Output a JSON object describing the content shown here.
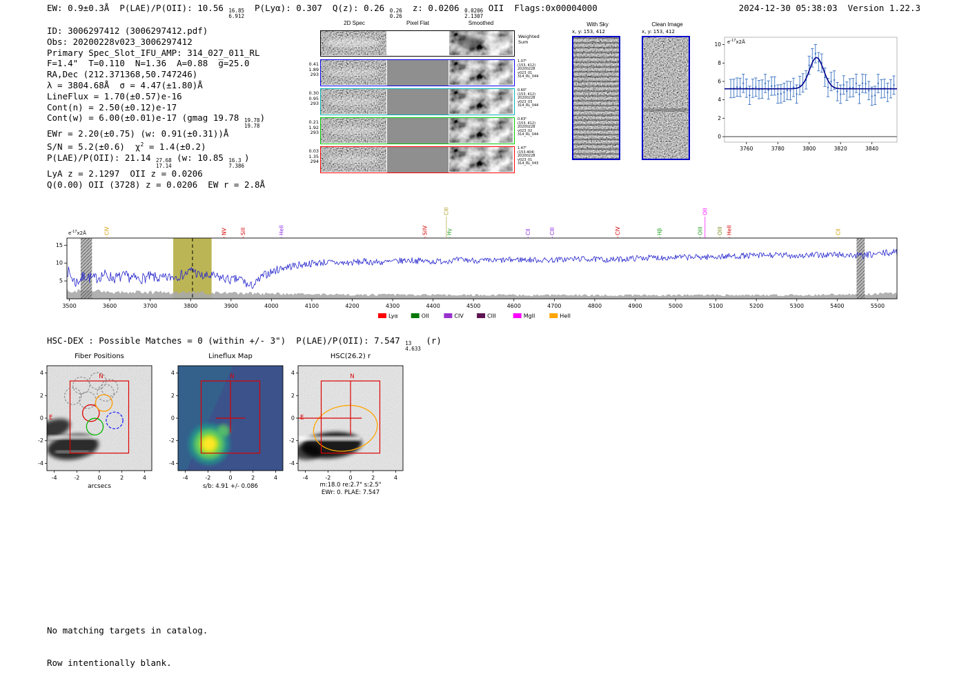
{
  "header": {
    "segments": [
      {
        "t": "EW: 0.9±0.3Å  P(LAE)/P(OII): 10.56 "
      },
      {
        "frac": [
          "16.85",
          "6.912"
        ]
      },
      {
        "t": "  P(Lyα): 0.307  Q(z): 0.26 "
      },
      {
        "frac": [
          "0.26",
          "0.26"
        ]
      },
      {
        "t": "  z: 0.0206 "
      },
      {
        "frac": [
          "0.0206",
          "2.1307"
        ]
      },
      {
        "t": " OII  Flags:0x00004000"
      }
    ],
    "timestamp": "2024-12-30 05:38:03  Version 1.22.3"
  },
  "info_lines": [
    [
      {
        "t": "ID: 3006297412 (3006297412.pdf)"
      }
    ],
    [
      {
        "t": "Obs: 20200228v023_3006297412"
      }
    ],
    [
      {
        "t": "Primary Spec_Slot_IFU_AMP: 314_027_011_RL"
      }
    ],
    [
      {
        "t": "F=1.4\"  T=0.110  N=1.36  A=0.88  g̅=25.0"
      }
    ],
    [
      {
        "t": "RA,Dec (212.371368,50.747246)"
      }
    ],
    [
      {
        "t": "λ = 3804.68Å  σ = 4.47(±1.80)Å"
      }
    ],
    [
      {
        "t": "LineFlux = 1.70(±0.57)e-16"
      }
    ],
    [
      {
        "t": "Cont(n) = 2.50(±0.12)e-17"
      }
    ],
    [
      {
        "t": "Cont(w) = 6.00(±0.01)e-17 (gmag 19.78 "
      },
      {
        "frac": [
          "19.78",
          "19.78"
        ]
      },
      {
        "t": ")"
      }
    ],
    [
      {
        "t": "EWr = 2.20(±0.75) (w: 0.91(±0.31))Å"
      }
    ],
    [
      {
        "t": "S/N = 5.2(±0.6)  χ"
      },
      {
        "sup": "2"
      },
      {
        "t": " = 1.4(±0.2)"
      }
    ],
    [
      {
        "t": "P(LAE)/P(OII): 21.14 "
      },
      {
        "frac": [
          "27.68",
          "17.14"
        ]
      },
      {
        "t": " (w: 10.85 "
      },
      {
        "frac": [
          "16.3",
          "7.386"
        ]
      },
      {
        "t": ")"
      }
    ],
    [
      {
        "t": "LyA z = 2.1297  OII z = 0.0206"
      }
    ],
    [
      {
        "t": "Q(0.00) OII (3728) z = 0.0206  EW r = 2.8Å"
      }
    ]
  ],
  "cutouts": {
    "col_titles": [
      "2D Spec",
      "Pixel Flat",
      "Smoothed"
    ],
    "weighted_label_1": "Weighted",
    "weighted_label_2": "Sum",
    "rows": [
      {
        "left": [
          "0.41",
          "1.89",
          "293"
        ],
        "right": [
          "1.07\"",
          "(153, 412)",
          "20200228",
          "v023_01",
          "314_RL_044"
        ],
        "border": "#0000ee"
      },
      {
        "left": [
          "0.30",
          "0.95",
          "293"
        ],
        "right": [
          "0.60\"",
          "(153, 412)",
          "20200228",
          "v023_03",
          "314_RL_044"
        ],
        "border": "#00b2b2"
      },
      {
        "left": [
          "0.21",
          "1.92",
          "293"
        ],
        "right": [
          "0.83\"",
          "(153, 412)",
          "20200228",
          "v023_02",
          "314_RL_044"
        ],
        "border": "#00cc00"
      },
      {
        "left": [
          "0.03",
          "1.35",
          "294"
        ],
        "right": [
          "1.47\"",
          "(153.404)",
          "20200228",
          "v023_01",
          "314_RL_043"
        ],
        "border": "#ff0000"
      }
    ]
  },
  "sky_panels": [
    {
      "title": "With Sky",
      "coords": "x, y: 153, 412"
    },
    {
      "title": "Clean Image",
      "coords": "x, y: 153, 412"
    }
  ],
  "chart_data": [
    {
      "id": "line-fit-zoom",
      "type": "scatter",
      "title": "",
      "unit_label": {
        "base": "e",
        "exp": "-17",
        "rest": "x2Å"
      },
      "xlim": [
        3746,
        3856
      ],
      "ylim": [
        -0.6,
        10.8
      ],
      "xticks": [
        3760,
        3780,
        3800,
        3820,
        3840
      ],
      "yticks": [
        0,
        2,
        4,
        6,
        8,
        10
      ],
      "model": {
        "baseline": 5.2,
        "mu": 3804.68,
        "sigma": 4.47,
        "amplitude": 3.4
      },
      "points": {
        "x_start": 3750,
        "x_step": 2,
        "n": 53,
        "noise_amp": 0.85,
        "error_bar": 1.0,
        "seed": 11
      },
      "colors": {
        "marker": "#3a72c0",
        "fit": "#00008b",
        "zero_line": "#8f8f8f"
      }
    },
    {
      "id": "full-spectrum",
      "type": "line",
      "title": "",
      "unit_label": {
        "base": "e",
        "exp": "-17",
        "rest": "x2Å"
      },
      "xlim": [
        3494,
        5548
      ],
      "ylim": [
        0,
        17
      ],
      "xticks": [
        3500,
        3600,
        3700,
        3800,
        3900,
        4000,
        4100,
        4200,
        4300,
        4400,
        4500,
        4600,
        4700,
        4800,
        4900,
        5000,
        5100,
        5200,
        5300,
        5400,
        5500
      ],
      "yticks": [
        5,
        10,
        15
      ],
      "step": 2,
      "seed": 4,
      "detect_wavelength": 3804.68,
      "highlight_band": [
        3757,
        3852
      ],
      "hatch_bands": [
        [
          3528,
          3556
        ],
        [
          5448,
          5468
        ]
      ],
      "colors": {
        "line": "#2222cc",
        "error_band": "#a8a8a8",
        "highlight": "#b5ad42"
      },
      "continuum": [
        [
          3494,
          8.0
        ],
        [
          3515,
          4.5
        ],
        [
          3540,
          6.5
        ],
        [
          3560,
          5.5
        ],
        [
          3585,
          6.8
        ],
        [
          3610,
          5.8
        ],
        [
          3640,
          6.3
        ],
        [
          3670,
          5.5
        ],
        [
          3700,
          6.2
        ],
        [
          3730,
          5.6
        ],
        [
          3760,
          6.3
        ],
        [
          3785,
          6.8
        ],
        [
          3800,
          7.8
        ],
        [
          3806,
          8.3
        ],
        [
          3815,
          7.0
        ],
        [
          3830,
          6.2
        ],
        [
          3850,
          6.4
        ],
        [
          3880,
          5.8
        ],
        [
          3900,
          5.2
        ],
        [
          3925,
          5.6
        ],
        [
          3945,
          3.4
        ],
        [
          3960,
          4.2
        ],
        [
          3980,
          6.5
        ],
        [
          4000,
          7.5
        ],
        [
          4030,
          8.8
        ],
        [
          4060,
          9.3
        ],
        [
          4090,
          9.8
        ],
        [
          4130,
          10.2
        ],
        [
          4180,
          10.0
        ],
        [
          4230,
          10.4
        ],
        [
          4280,
          10.2
        ],
        [
          4340,
          10.8
        ],
        [
          4400,
          10.4
        ],
        [
          4470,
          10.9
        ],
        [
          4540,
          10.6
        ],
        [
          4610,
          11.0
        ],
        [
          4680,
          10.8
        ],
        [
          4760,
          11.2
        ],
        [
          4840,
          10.9
        ],
        [
          4920,
          11.5
        ],
        [
          5000,
          11.6
        ],
        [
          5080,
          11.7
        ],
        [
          5160,
          12.0
        ],
        [
          5240,
          12.2
        ],
        [
          5320,
          12.1
        ],
        [
          5400,
          12.4
        ],
        [
          5460,
          12.0
        ],
        [
          5520,
          12.8
        ],
        [
          5548,
          13.0
        ]
      ],
      "noise_amp": [
        [
          3494,
          1.7
        ],
        [
          3700,
          1.5
        ],
        [
          3900,
          1.3
        ],
        [
          4100,
          1.0
        ],
        [
          4400,
          0.85
        ],
        [
          4800,
          0.8
        ],
        [
          5200,
          0.85
        ],
        [
          5548,
          1.0
        ]
      ],
      "error_band": [
        [
          3494,
          2.3
        ],
        [
          3600,
          1.9
        ],
        [
          3800,
          1.7
        ],
        [
          3950,
          1.5
        ],
        [
          4100,
          1.25
        ],
        [
          4300,
          1.1
        ],
        [
          4600,
          1.0
        ],
        [
          5000,
          1.0
        ],
        [
          5300,
          1.05
        ],
        [
          5460,
          1.3
        ],
        [
          5548,
          1.5
        ]
      ],
      "emission_labels": [
        {
          "label": "CIV",
          "wl": 3593,
          "color": "#d39c00",
          "high": false
        },
        {
          "label": "NV",
          "wl": 3883,
          "color": "#d40000",
          "high": false
        },
        {
          "label": "SiII",
          "wl": 3930,
          "color": "#d40000",
          "high": false
        },
        {
          "label": "HeII",
          "wl": 4025,
          "color": "#8a2be2",
          "high": false
        },
        {
          "label": "SiIV",
          "wl": 4380,
          "color": "#d40000",
          "high": false
        },
        {
          "label": "CIII",
          "wl": 4433,
          "color": "#b0a32f",
          "high": true
        },
        {
          "label": "Hγ",
          "wl": 4441,
          "color": "#1f9e1f",
          "high": false
        },
        {
          "label": "CII",
          "wl": 4635,
          "color": "#8a2be2",
          "high": false
        },
        {
          "label": "CIII",
          "wl": 4695,
          "color": "#8a2be2",
          "high": false
        },
        {
          "label": "CIV",
          "wl": 4857,
          "color": "#d40000",
          "high": false
        },
        {
          "label": "Hβ",
          "wl": 4961,
          "color": "#1f9e1f",
          "high": false
        },
        {
          "label": "OIII",
          "wl": 5061,
          "color": "#1f9e1f",
          "high": false
        },
        {
          "label": "OII",
          "wl": 5073,
          "color": "#ff00ff",
          "high": true
        },
        {
          "label": "OIII",
          "wl": 5110,
          "color": "#7a8c1e",
          "high": false
        },
        {
          "label": "HeII",
          "wl": 5133,
          "color": "#d40000",
          "high": false
        },
        {
          "label": "CII",
          "wl": 5403,
          "color": "#d39c00",
          "high": false
        }
      ],
      "legend": [
        {
          "label": "Lyα",
          "color": "#ff0000"
        },
        {
          "label": "OII",
          "color": "#007700"
        },
        {
          "label": "CIV",
          "color": "#9932cc"
        },
        {
          "label": "CIII",
          "color": "#5d1451"
        },
        {
          "label": "MgII",
          "color": "#ff00ff"
        },
        {
          "label": "HeII",
          "color": "#ffa500"
        }
      ]
    }
  ],
  "hsc": {
    "summary_segments": [
      {
        "t": "HSC-DEX : Possible Matches = 0 (within +/- 3\")  P(LAE)/P(OII): 7.547 "
      },
      {
        "frac": [
          "13",
          "4.633"
        ]
      },
      {
        "t": " (r)"
      }
    ],
    "panels": [
      {
        "title": "Fiber Positions",
        "xlabel": "arcsecs",
        "xticks": [
          -4,
          -2,
          0,
          2,
          4
        ],
        "yticks": [
          -4,
          -2,
          0,
          2,
          4
        ],
        "compass": {
          "n": "N",
          "e": "E"
        },
        "ifu_box": [
          -2.6,
          -3.1,
          2.6,
          3.3
        ],
        "fibers": {
          "radius": 0.74,
          "gray_dashed": [
            [
              -1.6,
              2.9
            ],
            [
              -0.15,
              3.3
            ],
            [
              0.9,
              2.7
            ],
            [
              -1.05,
              1.6
            ],
            [
              -2.35,
              1.95
            ],
            [
              0.55,
              2.25
            ]
          ],
          "red": [
            [
              -0.75,
              0.45
            ]
          ],
          "orange": [
            [
              0.4,
              1.35
            ]
          ],
          "green": [
            [
              -0.4,
              -0.75
            ]
          ],
          "blue_dashed": [
            [
              1.35,
              -0.2
            ]
          ]
        }
      },
      {
        "title": "Lineflux Map",
        "caption": "s/b: 4.91 +/- 0.086",
        "xticks": [
          -4,
          -2,
          0,
          2,
          4
        ],
        "yticks": [
          -4,
          -2,
          0,
          2,
          4
        ],
        "compass": {
          "n": "N"
        },
        "ifu_box": [
          -2.6,
          -3.1,
          2.6,
          3.3
        ],
        "blob_center": [
          -1.9,
          -2.3
        ]
      },
      {
        "title": "HSC(26.2) r",
        "caption": "m:18.0 re:2.7\" s:2.5\"",
        "caption2": "EWr: 0. PLAE: 7.547",
        "xticks": [
          -4,
          -2,
          0,
          2,
          4
        ],
        "yticks": [
          -4,
          -2,
          0,
          2,
          4
        ],
        "compass": {
          "n": "N",
          "e": "E"
        },
        "ifu_box": [
          -2.6,
          -3.1,
          2.6,
          3.3
        ],
        "ellipse": {
          "cx": -0.45,
          "cy": -0.9,
          "rx": 2.85,
          "ry": 2.0,
          "angle": -10
        }
      }
    ]
  },
  "footer": {
    "lines": [
      "No matching targets in catalog.",
      "Row intentionally blank."
    ]
  }
}
